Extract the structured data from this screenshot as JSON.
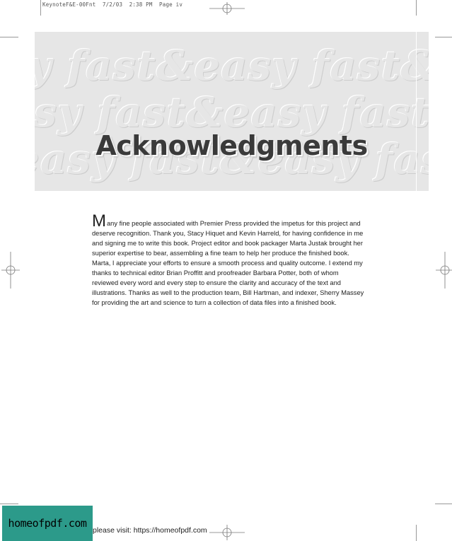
{
  "slug": "KeynoteF&E-00Fnt  7/2/03  2:38 PM  Page iv",
  "banner": {
    "watermark_rows": [
      "y  fast&easy  fast&easy  fast&easy",
      "asy  fast&easy  fast&easy  fast&easy",
      "easy  fast&easy  fast&easy  fast&easy"
    ],
    "title": "Acknowledgments"
  },
  "body": {
    "drop_cap": "M",
    "text": "any fine people associated with Premier Press provided the impetus for this project and deserve recognition. Thank you, Stacy Hiquet and Kevin Harreld, for having confidence in me and signing me to write this book. Project editor and book packager Marta Justak brought her superior expertise to bear, assembling a fine team to help her produce the finished book. Marta, I appreciate your efforts to ensure a smooth process and quality outcome. I extend my thanks to technical editor Brian Proffitt and proofreader Barbara Potter, both of whom reviewed every word and every step to ensure the clarity and accuracy of the text and illustrations. Thanks as well to the production team, Bill Hartman, and indexer, Sherry Massey for providing the art and science to turn a collection of data files into a finished book."
  },
  "footer": {
    "logo": "homeofpdf.com",
    "text": "please visit: https://homeofpdf.com"
  },
  "colors": {
    "banner_bg": "#e6e6e6",
    "logo_bg": "#2c9a8a"
  }
}
